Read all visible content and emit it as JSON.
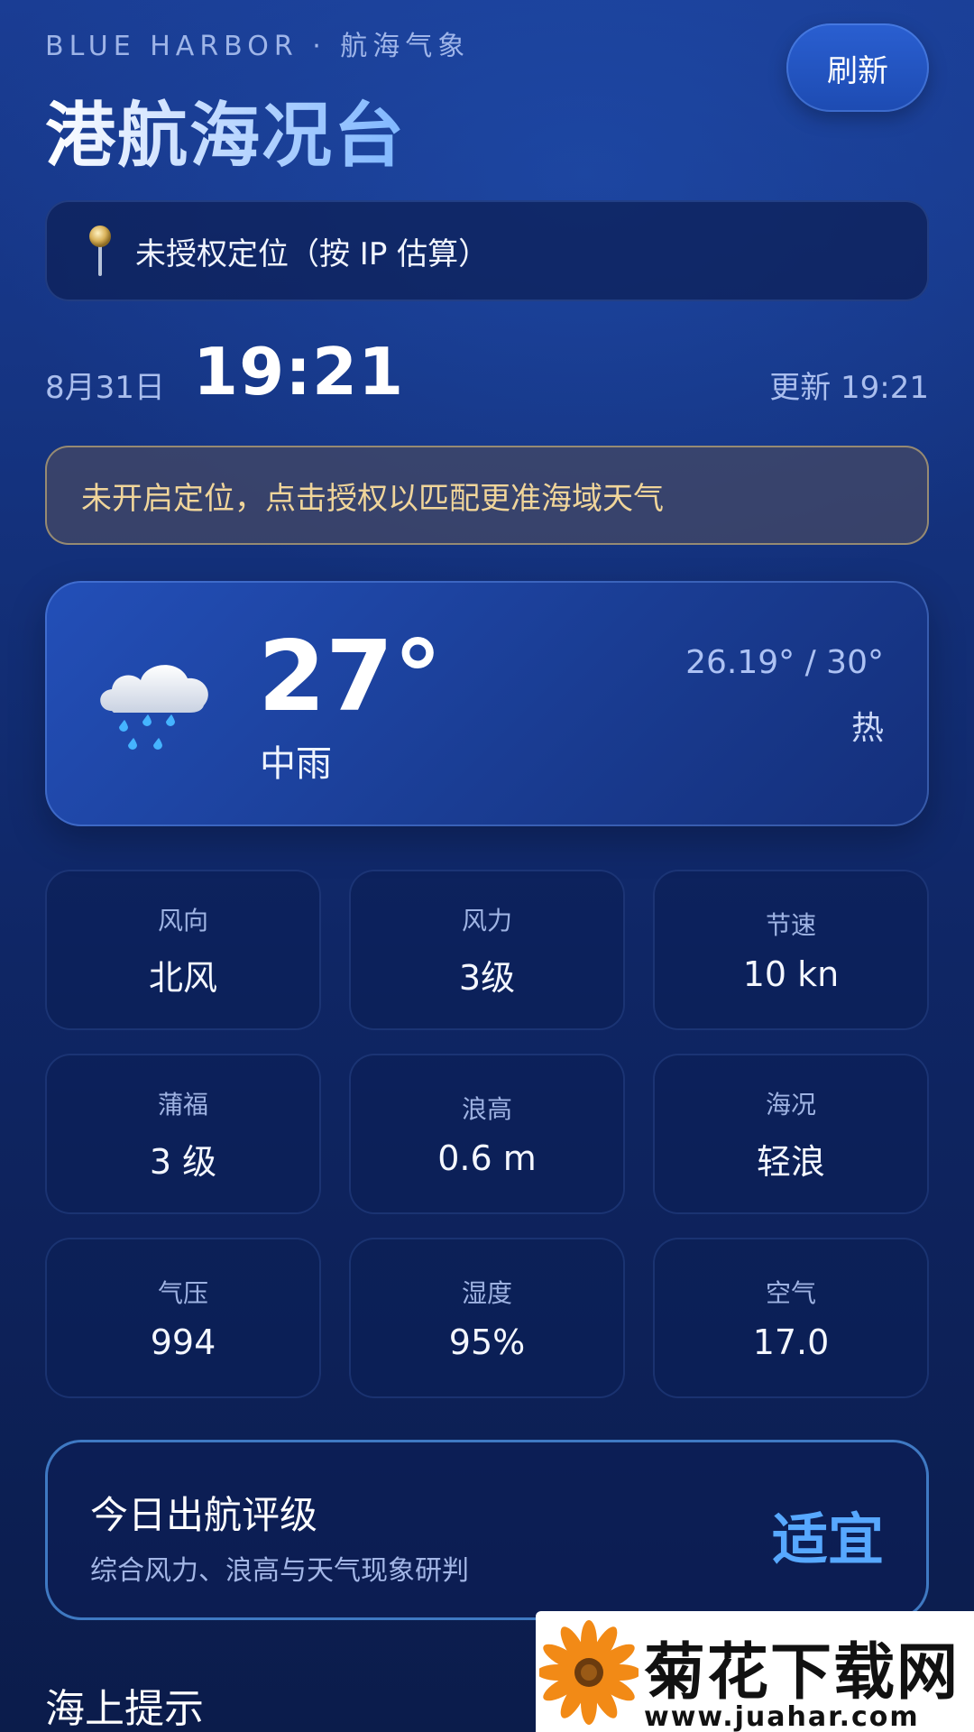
{
  "header": {
    "brand": "BLUE HARBOR · 航海气象",
    "title": "港航海况台",
    "refresh_label": "刷新"
  },
  "location": {
    "icon": "pin-icon",
    "text": "未授权定位（按 IP 估算）"
  },
  "status_bar": {
    "date": "8月31日",
    "time": "19:21",
    "updated": "更新 19:21"
  },
  "notice": {
    "text": "未开启定位，点击授权以匹配更准海域天气",
    "border_color": "#d6ba78"
  },
  "current_weather": {
    "icon": "rain-cloud-icon",
    "temperature": "27°",
    "condition": "中雨",
    "range": "26.19° / 30°",
    "feel": "热"
  },
  "metrics": [
    {
      "label": "风向",
      "value": "北风"
    },
    {
      "label": "风力",
      "value": "3级"
    },
    {
      "label": "节速",
      "value": "10 kn"
    },
    {
      "label": "蒲福",
      "value": "3 级"
    },
    {
      "label": "浪高",
      "value": "0.6 m"
    },
    {
      "label": "海况",
      "value": "轻浪"
    },
    {
      "label": "气压",
      "value": "994"
    },
    {
      "label": "湿度",
      "value": "95%"
    },
    {
      "label": "空气",
      "value": "17.0"
    }
  ],
  "rating": {
    "title": "今日出航评级",
    "subtitle": "综合风力、浪高与天气现象研判",
    "value": "适宜",
    "accent_color": "#57a8ff"
  },
  "section": {
    "title": "海上提示"
  },
  "watermark": {
    "text": "菊花下载网",
    "url": "www.juahar.com",
    "icon": "flower-icon"
  }
}
